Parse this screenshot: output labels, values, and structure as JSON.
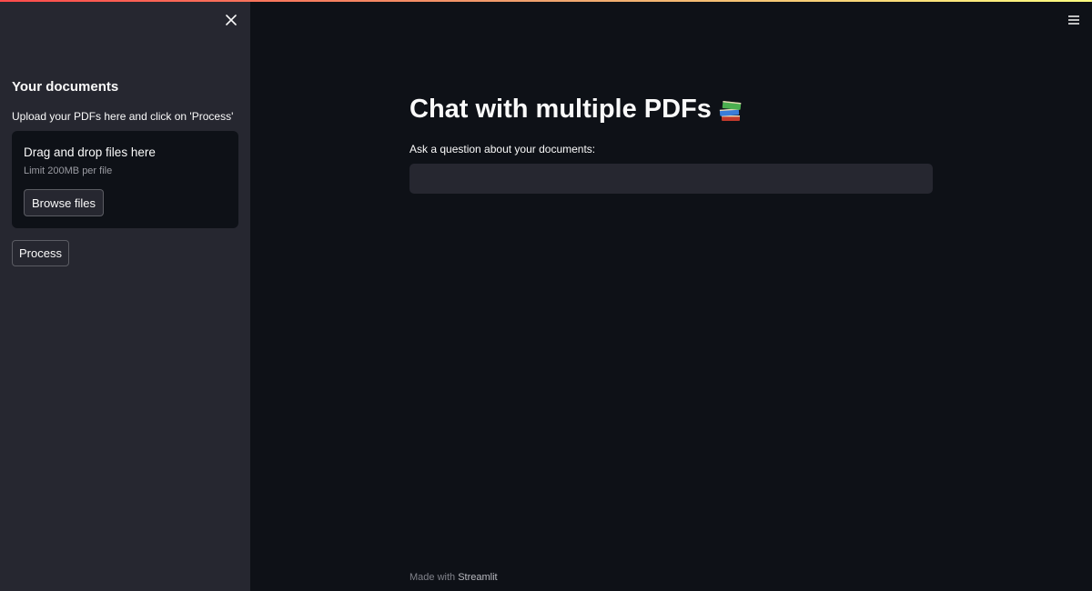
{
  "sidebar": {
    "title": "Your documents",
    "subtitle": "Upload your PDFs here and click on 'Process'",
    "dropzone": {
      "title": "Drag and drop files here",
      "limit": "Limit 200MB per file",
      "browse_label": "Browse files"
    },
    "process_label": "Process",
    "close_icon": "close-icon"
  },
  "main": {
    "title": "Chat with multiple PDFs",
    "title_icon": "books-icon",
    "question_label": "Ask a question about your documents:",
    "question_value": "",
    "menu_icon": "hamburger-menu-icon"
  },
  "footer": {
    "prefix": "Made with",
    "brand": "Streamlit"
  },
  "colors": {
    "background": "#0e1117",
    "sidebar": "#262730",
    "text": "#fafafa",
    "muted": "#9a9ba2",
    "accent_gradient_start": "#ff4b4b",
    "accent_gradient_end": "#fffd80"
  }
}
